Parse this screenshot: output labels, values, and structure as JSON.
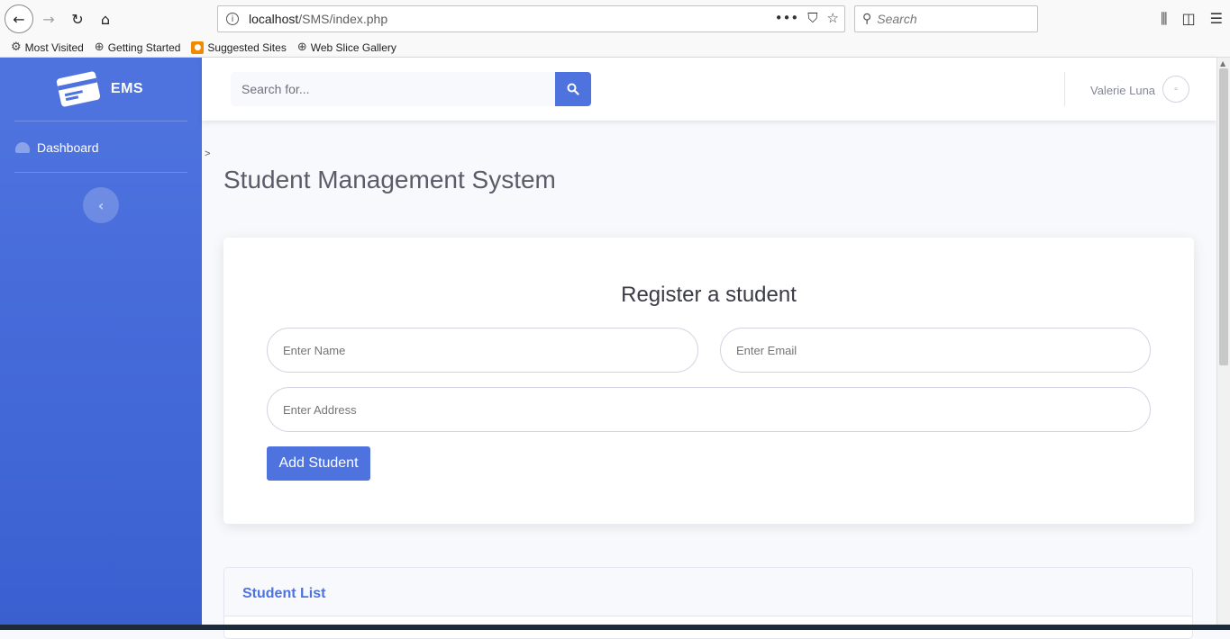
{
  "browser": {
    "url_host": "localhost",
    "url_path": "/SMS/index.php",
    "search_placeholder": "Search",
    "bookmarks": [
      "Most Visited",
      "Getting Started",
      "Suggested Sites",
      "Web Slice Gallery"
    ]
  },
  "sidebar": {
    "brand": "EMS",
    "items": [
      {
        "label": "Dashboard",
        "icon": "tachometer-icon"
      }
    ],
    "toggle_glyph": "‹"
  },
  "topbar": {
    "search_placeholder": "Search for...",
    "user_name": "Valerie Luna"
  },
  "main": {
    "caret": ">",
    "title": "Student Management System",
    "form": {
      "title": "Register a student",
      "name_placeholder": "Enter Name",
      "email_placeholder": "Enter Email",
      "address_placeholder": "Enter Address",
      "submit_label": "Add Student"
    },
    "list": {
      "title": "Student List"
    }
  },
  "colors": {
    "primary": "#4e73df",
    "page_bg": "#f8f9fc"
  }
}
